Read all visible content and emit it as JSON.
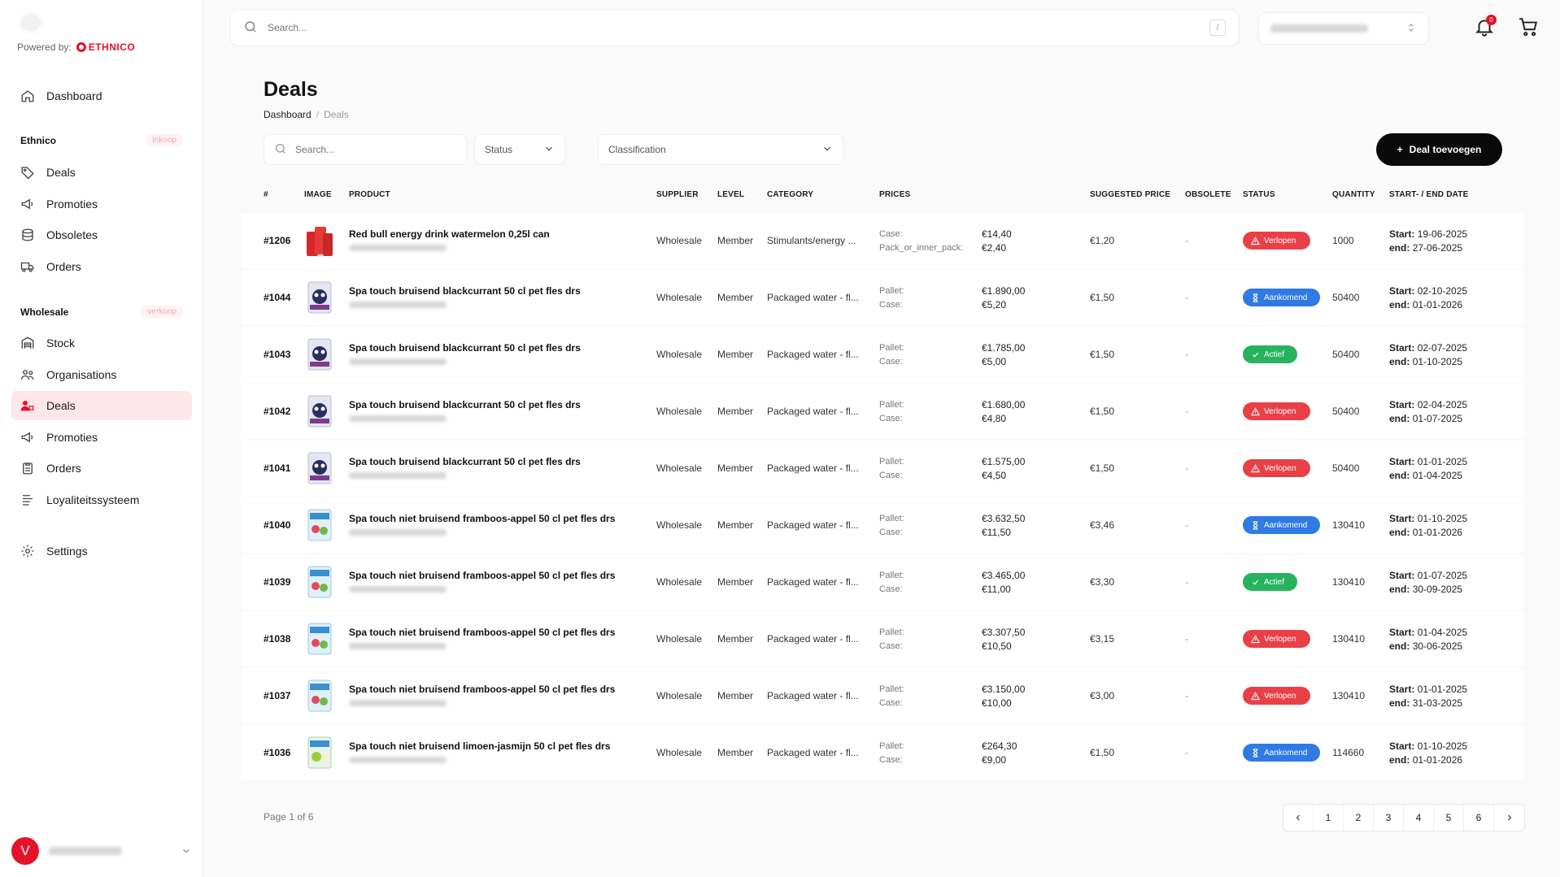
{
  "sidebar": {
    "powered_by": "Powered by:",
    "brand": "ETHNICO",
    "dashboard": "Dashboard",
    "section1": {
      "title": "Ethnico",
      "tag": "inkoop"
    },
    "section1_items": [
      "Deals",
      "Promoties",
      "Obsoletes",
      "Orders"
    ],
    "section2": {
      "title": "Wholesale",
      "tag": "verkoop"
    },
    "section2_items": [
      "Stock",
      "Organisations",
      "Deals",
      "Promoties",
      "Orders",
      "Loyaliteitssysteem"
    ],
    "settings": "Settings",
    "avatar_letter": "V"
  },
  "topbar": {
    "search_placeholder": "Search...",
    "shortcut": "/",
    "notifications": "0"
  },
  "page": {
    "title": "Deals",
    "breadcrumb": [
      "Dashboard",
      "Deals"
    ],
    "filter_search_placeholder": "Search...",
    "status_filter": "Status",
    "classification_filter": "Classification",
    "add_button": "Deal toevoegen"
  },
  "table": {
    "headers": [
      "#",
      "IMAGE",
      "PRODUCT",
      "SUPPLIER",
      "LEVEL",
      "CATEGORY",
      "PRICES",
      "SUGGESTED PRICE",
      "OBSOLETE",
      "STATUS",
      "QUANTITY",
      "START- / END DATE"
    ],
    "rows": [
      {
        "id": "#1206",
        "product": "Red bull energy drink watermelon 0,25l can",
        "supplier": "Wholesale",
        "level": "Member",
        "category": "Stimulants/energy ...",
        "price_labels": [
          "Case:",
          "Pack_or_inner_pack:"
        ],
        "price_values": [
          "€14,40",
          "€2,40"
        ],
        "suggested": "€1,20",
        "obsolete": "-",
        "status": "Verlopen",
        "status_color": "red",
        "quantity": "1000",
        "start": "19-06-2025",
        "end": "27-06-2025",
        "thumb": "redbull"
      },
      {
        "id": "#1044",
        "product": "Spa touch bruisend blackcurrant 50 cl pet fles drs",
        "supplier": "Wholesale",
        "level": "Member",
        "category": "Packaged water - fl...",
        "price_labels": [
          "Pallet:",
          "Case:"
        ],
        "price_values": [
          "€1.890,00",
          "€5,20"
        ],
        "suggested": "€1,50",
        "obsolete": "-",
        "status": "Aankomend",
        "status_color": "blue",
        "quantity": "50400",
        "start": "02-10-2025",
        "end": "01-01-2026",
        "thumb": "black"
      },
      {
        "id": "#1043",
        "product": "Spa touch bruisend blackcurrant 50 cl pet fles drs",
        "supplier": "Wholesale",
        "level": "Member",
        "category": "Packaged water - fl...",
        "price_labels": [
          "Pallet:",
          "Case:"
        ],
        "price_values": [
          "€1.785,00",
          "€5,00"
        ],
        "suggested": "€1,50",
        "obsolete": "-",
        "status": "Actief",
        "status_color": "green",
        "quantity": "50400",
        "start": "02-07-2025",
        "end": "01-10-2025",
        "thumb": "black"
      },
      {
        "id": "#1042",
        "product": "Spa touch bruisend blackcurrant 50 cl pet fles drs",
        "supplier": "Wholesale",
        "level": "Member",
        "category": "Packaged water - fl...",
        "price_labels": [
          "Pallet:",
          "Case:"
        ],
        "price_values": [
          "€1.680,00",
          "€4,80"
        ],
        "suggested": "€1,50",
        "obsolete": "-",
        "status": "Verlopen",
        "status_color": "red",
        "quantity": "50400",
        "start": "02-04-2025",
        "end": "01-07-2025",
        "thumb": "black"
      },
      {
        "id": "#1041",
        "product": "Spa touch bruisend blackcurrant 50 cl pet fles drs",
        "supplier": "Wholesale",
        "level": "Member",
        "category": "Packaged water - fl...",
        "price_labels": [
          "Pallet:",
          "Case:"
        ],
        "price_values": [
          "€1.575,00",
          "€4,50"
        ],
        "suggested": "€1,50",
        "obsolete": "-",
        "status": "Verlopen",
        "status_color": "red",
        "quantity": "50400",
        "start": "01-01-2025",
        "end": "01-04-2025",
        "thumb": "black"
      },
      {
        "id": "#1040",
        "product": "Spa touch niet bruisend framboos-appel 50 cl pet fles drs",
        "supplier": "Wholesale",
        "level": "Member",
        "category": "Packaged water - fl...",
        "price_labels": [
          "Pallet:",
          "Case:"
        ],
        "price_values": [
          "€3.632,50",
          "€11,50"
        ],
        "suggested": "€3,46",
        "obsolete": "-",
        "status": "Aankomend",
        "status_color": "blue",
        "quantity": "130410",
        "start": "01-10-2025",
        "end": "01-01-2026",
        "thumb": "rasp"
      },
      {
        "id": "#1039",
        "product": "Spa touch niet bruisend framboos-appel 50 cl pet fles drs",
        "supplier": "Wholesale",
        "level": "Member",
        "category": "Packaged water - fl...",
        "price_labels": [
          "Pallet:",
          "Case:"
        ],
        "price_values": [
          "€3.465,00",
          "€11,00"
        ],
        "suggested": "€3,30",
        "obsolete": "-",
        "status": "Actief",
        "status_color": "green",
        "quantity": "130410",
        "start": "01-07-2025",
        "end": "30-09-2025",
        "thumb": "rasp"
      },
      {
        "id": "#1038",
        "product": "Spa touch niet bruisend framboos-appel 50 cl pet fles drs",
        "supplier": "Wholesale",
        "level": "Member",
        "category": "Packaged water - fl...",
        "price_labels": [
          "Pallet:",
          "Case:"
        ],
        "price_values": [
          "€3.307,50",
          "€10,50"
        ],
        "suggested": "€3,15",
        "obsolete": "-",
        "status": "Verlopen",
        "status_color": "red",
        "quantity": "130410",
        "start": "01-04-2025",
        "end": "30-06-2025",
        "thumb": "rasp"
      },
      {
        "id": "#1037",
        "product": "Spa touch niet bruisend framboos-appel 50 cl pet fles drs",
        "supplier": "Wholesale",
        "level": "Member",
        "category": "Packaged water - fl...",
        "price_labels": [
          "Pallet:",
          "Case:"
        ],
        "price_values": [
          "€3.150,00",
          "€10,00"
        ],
        "suggested": "€3,00",
        "obsolete": "-",
        "status": "Verlopen",
        "status_color": "red",
        "quantity": "130410",
        "start": "01-01-2025",
        "end": "31-03-2025",
        "thumb": "rasp"
      },
      {
        "id": "#1036",
        "product": "Spa touch niet bruisend limoen-jasmijn 50 cl pet fles drs",
        "supplier": "Wholesale",
        "level": "Member",
        "category": "Packaged water - fl...",
        "price_labels": [
          "Pallet:",
          "Case:"
        ],
        "price_values": [
          "€264,30",
          "€9,00"
        ],
        "suggested": "€1,50",
        "obsolete": "-",
        "status": "Aankomend",
        "status_color": "blue",
        "quantity": "114660",
        "start": "01-10-2025",
        "end": "01-01-2026",
        "thumb": "lime"
      }
    ],
    "start_label": "Start:",
    "end_label": "end:"
  },
  "pagination": {
    "info": "Page 1 of 6",
    "pages": [
      "1",
      "2",
      "3",
      "4",
      "5",
      "6"
    ]
  },
  "colors": {
    "accent": "#e5122a",
    "red": "#e94048",
    "blue": "#2f7ae5",
    "green": "#27b35e"
  }
}
